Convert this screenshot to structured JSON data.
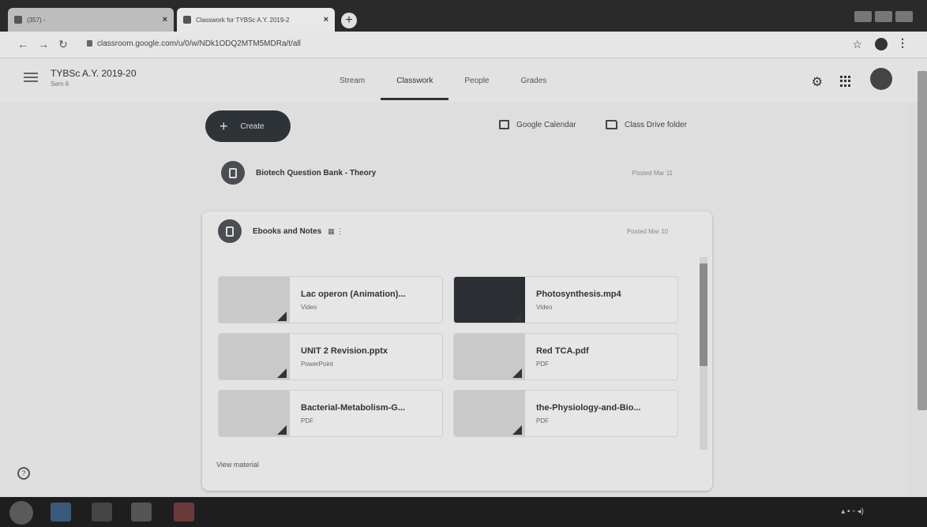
{
  "browser": {
    "tabs": [
      {
        "title": "(357) - ",
        "active": false
      },
      {
        "title": "Classwork for TYBSc A.Y. 2019-2",
        "active": true
      }
    ],
    "url": "classroom.google.com/u/0/w/NDk1ODQ2MTM5MDRa/t/all"
  },
  "header": {
    "class_title": "TYBSc A.Y. 2019-20",
    "class_section": "Sem 6",
    "tabs": [
      "Stream",
      "Classwork",
      "People",
      "Grades"
    ],
    "active_tab": "Classwork"
  },
  "toolbar": {
    "create_label": "Create",
    "calendar_label": "Google Calendar",
    "drive_label": "Class Drive folder"
  },
  "posts": [
    {
      "title": "Biotech Question Bank - Theory",
      "posted": "Posted Mar 11"
    }
  ],
  "expanded_post": {
    "title": "Ebooks and Notes",
    "posted": "Posted Mar 10",
    "materials": [
      {
        "title": "Lac operon (Animation)...",
        "type": "Video"
      },
      {
        "title": "Photosynthesis.mp4",
        "type": "Video"
      },
      {
        "title": "UNIT 2 Revision.pptx",
        "type": "PowerPoint"
      },
      {
        "title": "Red TCA.pdf",
        "type": "PDF"
      },
      {
        "title": "Bacterial-Metabolism-G...",
        "type": "PDF"
      },
      {
        "title": "the-Physiology-and-Bio...",
        "type": "PDF"
      }
    ],
    "view_label": "View material"
  },
  "icons": [
    "hamburger-icon",
    "gear-icon",
    "apps-icon",
    "calendar-icon",
    "folder-icon",
    "assignment-icon",
    "help-icon",
    "star-icon"
  ],
  "colors": {
    "accent": "#2e3338",
    "background": "#dedede"
  }
}
